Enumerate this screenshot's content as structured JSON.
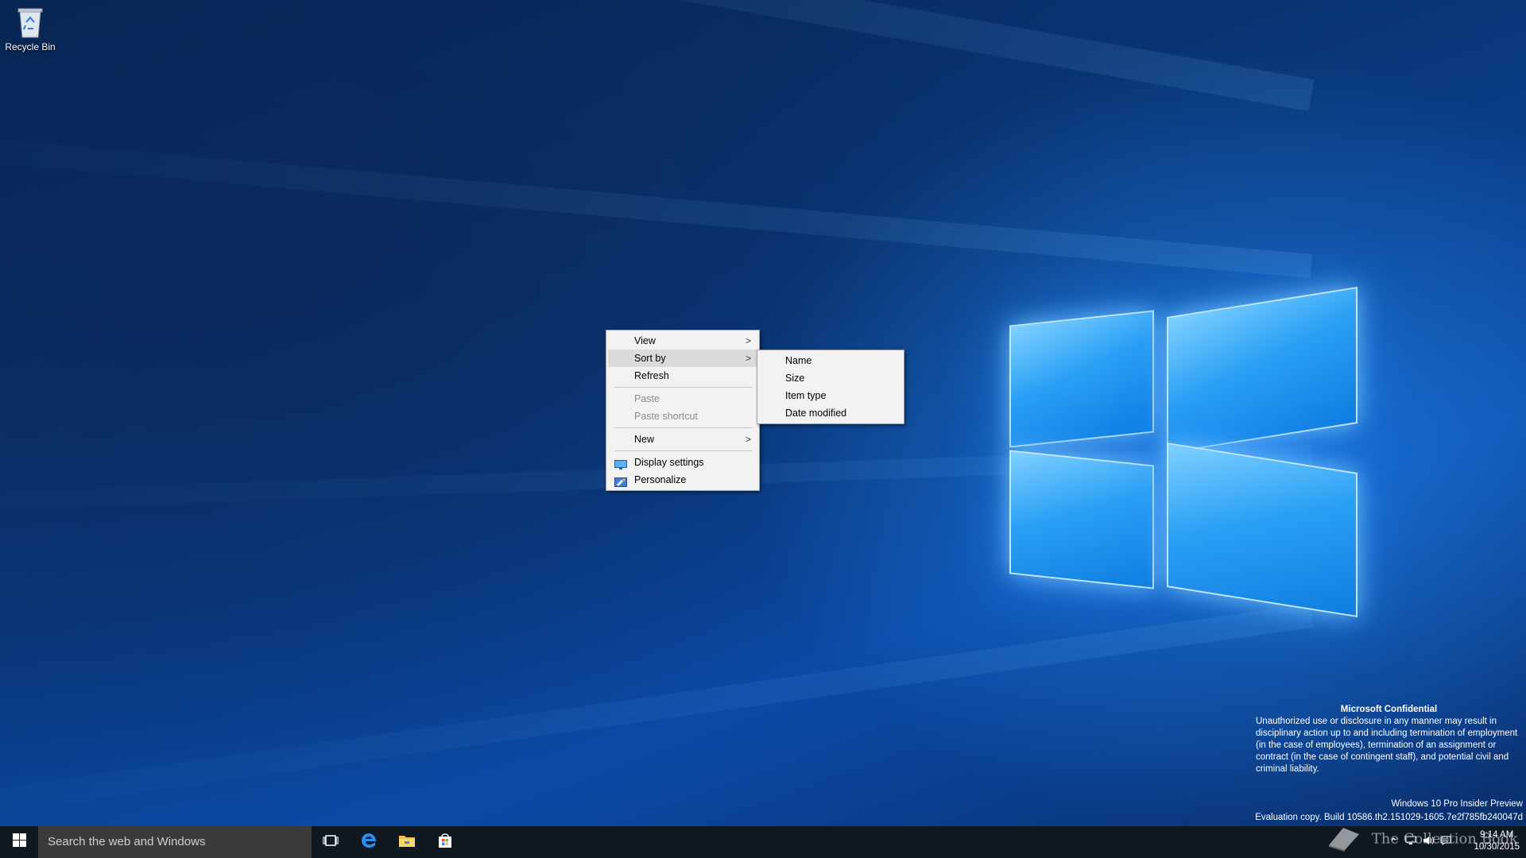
{
  "desktop": {
    "icons": [
      {
        "label": "Recycle Bin",
        "icon": "recycle-bin-icon"
      }
    ]
  },
  "context_menu": {
    "items": [
      {
        "label": "View",
        "has_submenu": true,
        "enabled": true
      },
      {
        "label": "Sort by",
        "has_submenu": true,
        "enabled": true,
        "highlighted": true
      },
      {
        "label": "Refresh",
        "enabled": true
      },
      {
        "label": "Paste",
        "enabled": false
      },
      {
        "label": "Paste shortcut",
        "enabled": false
      },
      {
        "label": "New",
        "has_submenu": true,
        "enabled": true
      },
      {
        "label": "Display settings",
        "enabled": true,
        "icon": "display-icon"
      },
      {
        "label": "Personalize",
        "enabled": true,
        "icon": "personalize-icon"
      }
    ],
    "arrow_glyph": ">"
  },
  "sort_submenu": {
    "items": [
      {
        "label": "Name"
      },
      {
        "label": "Size"
      },
      {
        "label": "Item type"
      },
      {
        "label": "Date modified"
      }
    ]
  },
  "watermark": {
    "title": "Microsoft Confidential",
    "text": "Unauthorized use or disclosure in any manner may result in disciplinary action up to and including termination of employment (in the case of employees), termination of an assignment or contract (in the case of contingent staff), and potential civil and criminal liability.",
    "edition": "Windows 10 Pro Insider Preview",
    "build": "Evaluation copy. Build 10586.th2.151029-1605.7e2f785fb240047d"
  },
  "taskbar": {
    "search_placeholder": "Search the web and Windows",
    "pinned": [
      "task-view-icon",
      "edge-icon",
      "file-explorer-icon",
      "store-icon"
    ],
    "clock_time": "9:14 AM",
    "clock_date": "10/30/2015"
  },
  "brand_watermark": "The Collection Book",
  "colors": {
    "taskbar": "#101820",
    "menu_bg": "#f2f2f2",
    "menu_highlight": "#dadada",
    "logo_glow": "#7fd0ff"
  }
}
